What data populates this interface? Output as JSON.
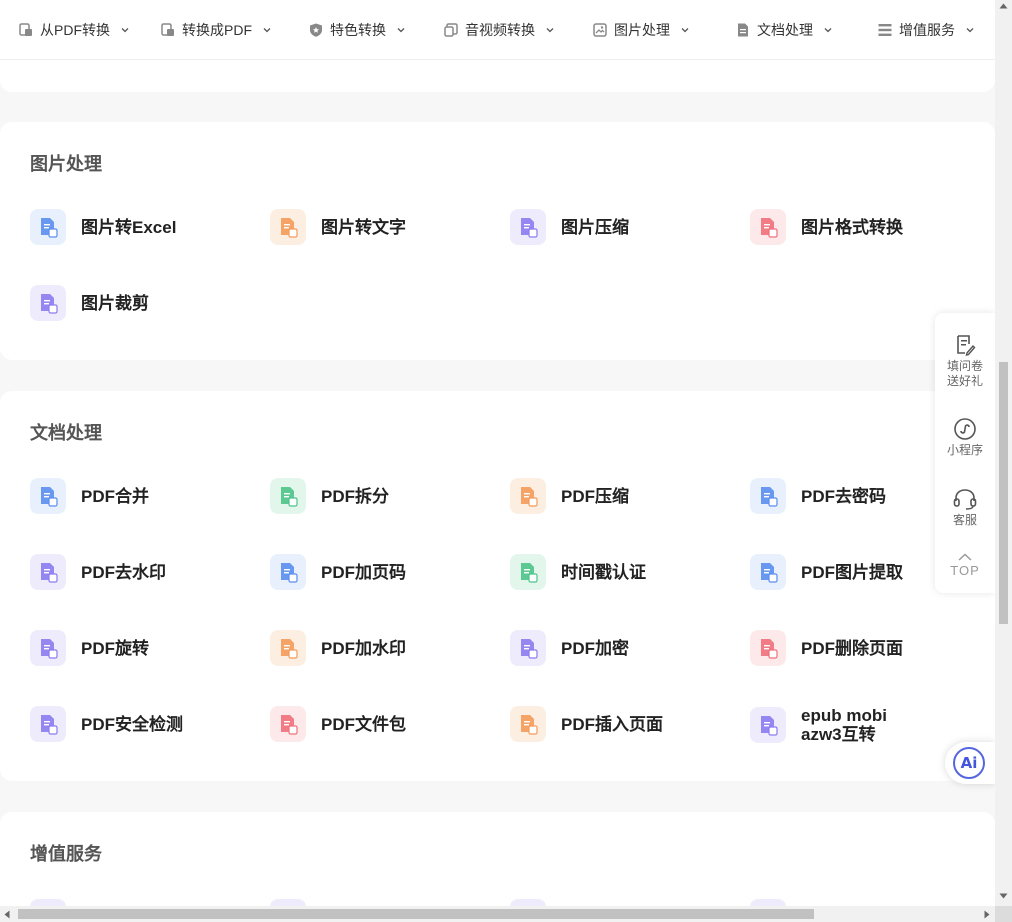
{
  "nav": {
    "items": [
      {
        "label": "从PDF转换"
      },
      {
        "label": "转换成PDF"
      },
      {
        "label": "特色转换"
      },
      {
        "label": "音视频转换"
      },
      {
        "label": "图片处理"
      },
      {
        "label": "文档处理"
      },
      {
        "label": "增值服务"
      }
    ]
  },
  "sections": {
    "image": {
      "title": "图片处理",
      "tools": [
        {
          "label": "图片转Excel",
          "color": "#5b8ef0",
          "bg": "#e8f0fe"
        },
        {
          "label": "图片转文字",
          "color": "#f59a5a",
          "bg": "#fdeee2"
        },
        {
          "label": "图片压缩",
          "color": "#8a7cf0",
          "bg": "#eeebfd"
        },
        {
          "label": "图片格式转换",
          "color": "#f0707a",
          "bg": "#fde8ea"
        },
        {
          "label": "图片裁剪",
          "color": "#8a7cf0",
          "bg": "#eeebfd"
        }
      ]
    },
    "document": {
      "title": "文档处理",
      "tools": [
        {
          "label": "PDF合并",
          "color": "#5b8ef0",
          "bg": "#e8f0fe"
        },
        {
          "label": "PDF拆分",
          "color": "#4cc48a",
          "bg": "#e3f6ec"
        },
        {
          "label": "PDF压缩",
          "color": "#f59a5a",
          "bg": "#fdeee2"
        },
        {
          "label": "PDF去密码",
          "color": "#5b8ef0",
          "bg": "#e8f0fe"
        },
        {
          "label": "PDF去水印",
          "color": "#8a7cf0",
          "bg": "#eeebfd"
        },
        {
          "label": "PDF加页码",
          "color": "#5b8ef0",
          "bg": "#e8f0fe"
        },
        {
          "label": "时间戳认证",
          "color": "#4cc48a",
          "bg": "#e3f6ec"
        },
        {
          "label": "PDF图片提取",
          "color": "#5b8ef0",
          "bg": "#e8f0fe"
        },
        {
          "label": "PDF旋转",
          "color": "#8a7cf0",
          "bg": "#eeebfd"
        },
        {
          "label": "PDF加水印",
          "color": "#f59a5a",
          "bg": "#fdeee2"
        },
        {
          "label": "PDF加密",
          "color": "#8a7cf0",
          "bg": "#eeebfd"
        },
        {
          "label": "PDF删除页面",
          "color": "#f0707a",
          "bg": "#fde8ea"
        },
        {
          "label": "PDF安全检测",
          "color": "#8a7cf0",
          "bg": "#eeebfd"
        },
        {
          "label": "PDF文件包",
          "color": "#f0707a",
          "bg": "#fde8ea"
        },
        {
          "label": "PDF插入页面",
          "color": "#f59a5a",
          "bg": "#fdeee2"
        },
        {
          "label": "epub mobi\nazw3互转",
          "color": "#8a7cf0",
          "bg": "#eeebfd"
        }
      ]
    },
    "value_added": {
      "title": "增值服务"
    }
  },
  "float_panel": {
    "survey_label": "填问卷\n送好礼",
    "miniprogram_label": "小程序",
    "service_label": "客服",
    "top_label": "TOP"
  },
  "ai_button": {
    "label": "Ai"
  }
}
